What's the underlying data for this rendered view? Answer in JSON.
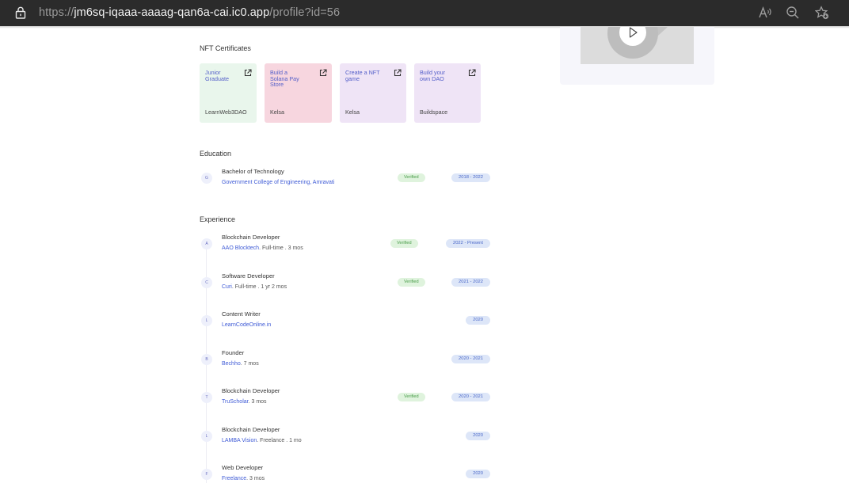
{
  "browser": {
    "url_scheme": "https://",
    "url_host": "jm6sq-iqaaa-aaaag-qan6a-cai.ic0.app",
    "url_path": "/profile?id=56",
    "icons": [
      "lock-icon",
      "read-aloud-icon",
      "zoom-out-icon",
      "add-favorite-icon"
    ]
  },
  "nft": {
    "title": "NFT Certificates",
    "cards": [
      {
        "title": "Junior Graduate",
        "issuer": "LearnWeb3DAO",
        "color": "#e9f6ec"
      },
      {
        "title": "Build a Solana Pay Store",
        "issuer": "Kelsa",
        "color": "#f7d6df"
      },
      {
        "title": "Create a NFT game",
        "issuer": "Kelsa",
        "color": "#efe4f6"
      },
      {
        "title": "Build your own DAO",
        "issuer": "Buildspace",
        "color": "#efe4f6"
      }
    ]
  },
  "education": {
    "title": "Education",
    "items": [
      {
        "initial": "G",
        "role": "Bachelor of Technology",
        "org": "Government College of Engineering, Amravati",
        "detail": "",
        "verified": "Verified",
        "dates": "2018 - 2022"
      }
    ]
  },
  "experience": {
    "title": "Experience",
    "items": [
      {
        "initial": "A",
        "role": "Blockchain Developer",
        "org": "AAO Blocktech",
        "detail": ". Full-time . 3 mos",
        "verified": "Verified",
        "dates": "2022 - Present"
      },
      {
        "initial": "C",
        "role": "Software Developer",
        "org": "Curi",
        "detail": ". Full-time . 1 yr 2 mos",
        "verified": "Verified",
        "dates": "2021 - 2022"
      },
      {
        "initial": "L",
        "role": "Content Writer",
        "org": "LearnCodeOnline.in",
        "detail": "",
        "verified": "",
        "dates": "2020"
      },
      {
        "initial": "B",
        "role": "Founder",
        "org": "Bechho",
        "detail": ". 7 mos",
        "verified": "",
        "dates": "2020 - 2021"
      },
      {
        "initial": "T",
        "role": "Blockchain Developer",
        "org": "TruScholar",
        "detail": ". 3 mos",
        "verified": "Verified",
        "dates": "2020 - 2021"
      },
      {
        "initial": "L",
        "role": "Blockchain Developer",
        "org": "LAMBA Vision",
        "detail": ". Freelance . 1 mo",
        "verified": "",
        "dates": "2020"
      },
      {
        "initial": "F",
        "role": "Web Developer",
        "org": "Freelance",
        "detail": ". 3 mos",
        "verified": "",
        "dates": "2020"
      }
    ]
  },
  "media": {
    "icon": "play-icon"
  }
}
